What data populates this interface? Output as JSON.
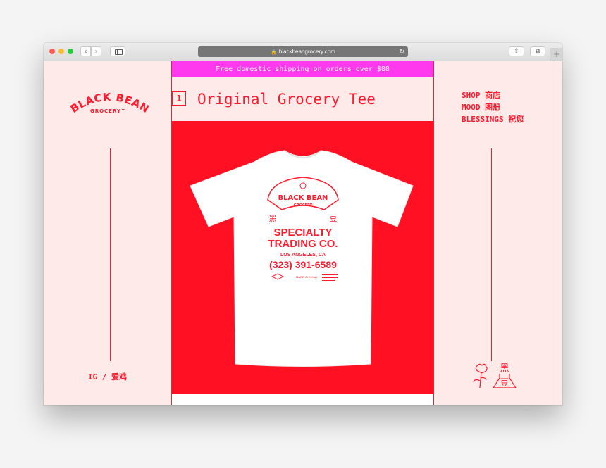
{
  "browser": {
    "url": "blackbeangrocery.com",
    "back_glyph": "‹",
    "forward_glyph": "›",
    "lock_glyph": "🔒",
    "reload_glyph": "↻",
    "share_glyph": "⇧",
    "tabs_glyph": "⧉",
    "new_tab_glyph": "+"
  },
  "banner": {
    "text": "Free domestic shipping on orders over $88"
  },
  "brand": {
    "name_top": "BLACK BEAN",
    "name_bottom": "GROCERY™"
  },
  "product": {
    "number": "1",
    "title": "Original Grocery Tee",
    "shirt_print": {
      "logo_top": "BLACK BEAN",
      "logo_bottom": "GROCERY",
      "char_left": "黑",
      "char_right": "豆",
      "line1": "SPECIALTY",
      "line2": "TRADING CO.",
      "location": "LOS ANGELES, CA",
      "phone": "(323) 391-6589",
      "made_in": "MADE IN CHINA"
    }
  },
  "nav": {
    "items": [
      {
        "label": "SHOP 商店"
      },
      {
        "label": "MOOD 图册"
      },
      {
        "label": "BLESSINGS 祝您"
      }
    ]
  },
  "social": {
    "ig_label": "IG / 爱鸡"
  },
  "mark": {
    "char_top": "黑",
    "char_bottom": "豆"
  },
  "colors": {
    "brand_red": "#ff1a2c",
    "hero_red": "#ff1123",
    "banner_pink": "#ff3aee",
    "page_bg": "#ffeaea"
  }
}
